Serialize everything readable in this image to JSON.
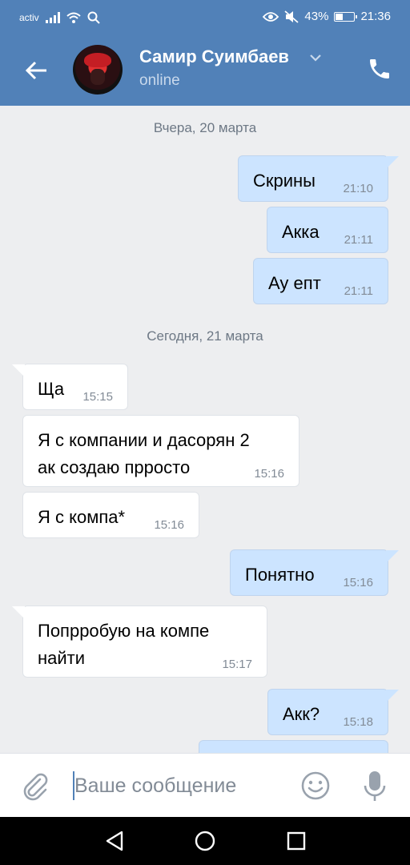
{
  "status_bar": {
    "carrier": "activ",
    "battery": "43%",
    "battery_level": 0.43,
    "time": "21:36"
  },
  "header": {
    "contact_name": "Самир Суимбаев",
    "contact_status": "online"
  },
  "chat": {
    "days": [
      {
        "label": "Вчера, 20 марта"
      },
      {
        "label": "Сегодня, 21 марта"
      }
    ],
    "messages": [
      {
        "direction": "outgoing",
        "lines": [
          "Скрины"
        ],
        "time": "21:10"
      },
      {
        "direction": "outgoing",
        "lines": [
          "Акка"
        ],
        "time": "21:11"
      },
      {
        "direction": "outgoing",
        "lines": [
          "Ау епт"
        ],
        "time": "21:11"
      },
      {
        "direction": "incoming",
        "lines": [
          "Ща"
        ],
        "time": "15:15"
      },
      {
        "direction": "incoming",
        "lines": [
          "Я с компании и дасорян 2",
          "ак  создаю  прросто"
        ],
        "time": "15:16"
      },
      {
        "direction": "incoming",
        "lines": [
          "Я с компа*"
        ],
        "time": "15:16"
      },
      {
        "direction": "outgoing",
        "lines": [
          "Понятно"
        ],
        "time": "15:16"
      },
      {
        "direction": "incoming",
        "lines": [
          "Попрробую на компе",
          "найти"
        ],
        "time": "15:17"
      },
      {
        "direction": "outgoing",
        "lines": [
          "Акк?"
        ],
        "time": "15:18"
      }
    ]
  },
  "composer": {
    "placeholder": "Ваше сообщение",
    "value": ""
  },
  "icons": {
    "back": "arrow-left-icon",
    "dropdown": "chevron-down-icon",
    "call": "phone-icon",
    "attach": "paperclip-icon",
    "emoji": "smile-icon",
    "voice": "microphone-icon",
    "nav_back": "triangle-back-icon",
    "nav_home": "circle-home-icon",
    "nav_recents": "square-recents-icon"
  },
  "colors": {
    "header": "#5181b8",
    "outgoing_bubble": "#cce4ff",
    "incoming_bubble": "#ffffff",
    "background": "#edeef0"
  }
}
